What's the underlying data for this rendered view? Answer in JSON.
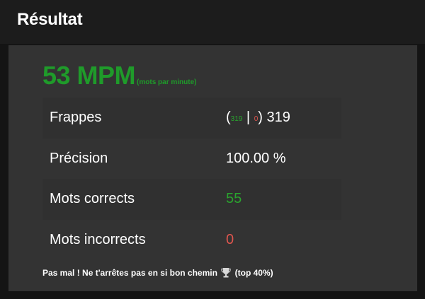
{
  "header": {
    "title": "Résultat"
  },
  "wpm": {
    "value": "53 MPM",
    "unit": "(mots par minute)"
  },
  "stats": {
    "keystrokes": {
      "label": "Frappes",
      "open": "(",
      "correct": "319",
      "sep": "|",
      "wrong": "0",
      "close": ")",
      "total": "319"
    },
    "accuracy": {
      "label": "Précision",
      "value": "100.00 %"
    },
    "correct_words": {
      "label": "Mots corrects",
      "value": "55"
    },
    "wrong_words": {
      "label": "Mots incorrects",
      "value": "0"
    }
  },
  "message": {
    "text": "Pas mal ! Ne t'arrêtes pas en si bon chemin",
    "icon": "trophy-icon",
    "rank": "(top 40%)"
  },
  "colors": {
    "accent_green": "#1f9b2a",
    "error_red": "#e0564f",
    "panel": "#333333",
    "header": "#1c1c1c"
  }
}
